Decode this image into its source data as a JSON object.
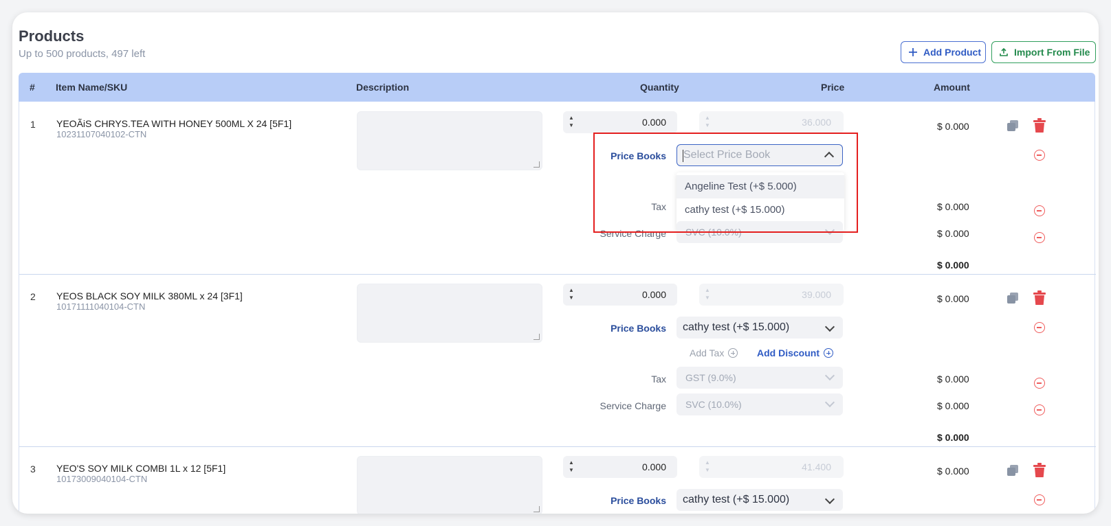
{
  "header": {
    "title": "Products",
    "subtitle": "Up to 500 products, 497 left",
    "add_product": "Add Product",
    "import_file": "Import From File"
  },
  "table": {
    "columns": [
      "#",
      "Item Name/SKU",
      "Description",
      "Quantity",
      "Price",
      "Amount"
    ]
  },
  "rows": [
    {
      "num": "1",
      "name": "YEOÃiS CHRYS.TEA WITH HONEY 500ML X 24 [5F1]",
      "sku": "10231107040102-CTN",
      "qty": "0.000",
      "price": "36.000",
      "amount": "$ 0.000",
      "price_books_label": "Price Books",
      "price_book_placeholder": "Select Price Book",
      "tax_label": "Tax",
      "tax_amount": "$ 0.000",
      "svc_label": "Service Charge",
      "svc_value": "SVC (10.0%)",
      "svc_amount": "$ 0.000",
      "total": "$ 0.000"
    },
    {
      "num": "2",
      "name": "YEOS BLACK SOY MILK 380ML x 24 [3F1]",
      "sku": "10171111040104-CTN",
      "qty": "0.000",
      "price": "39.000",
      "amount": "$ 0.000",
      "price_books_label": "Price Books",
      "price_book_value": "cathy test (+$ 15.000)",
      "add_tax": "Add Tax",
      "add_discount": "Add Discount",
      "tax_label": "Tax",
      "tax_value": "GST (9.0%)",
      "tax_amount": "$ 0.000",
      "svc_label": "Service Charge",
      "svc_value": "SVC (10.0%)",
      "svc_amount": "$ 0.000",
      "total": "$ 0.000"
    },
    {
      "num": "3",
      "name": "YEO'S SOY MILK COMBI 1L x 12 [5F1]",
      "sku": "10173009040104-CTN",
      "qty": "0.000",
      "price": "41.400",
      "amount": "$ 0.000",
      "price_books_label": "Price Books",
      "price_book_value": "cathy test (+$ 15.000)"
    }
  ],
  "dropdown": {
    "options": [
      "Angeline Test (+$ 5.000)",
      "cathy test (+$ 15.000)"
    ]
  },
  "colors": {
    "header_bg": "#b8cdf7",
    "primary_blue": "#2f5bc4",
    "import_green": "#238a4c",
    "danger_red": "#ef5b5b",
    "highlight_box": "#e41e1e"
  }
}
